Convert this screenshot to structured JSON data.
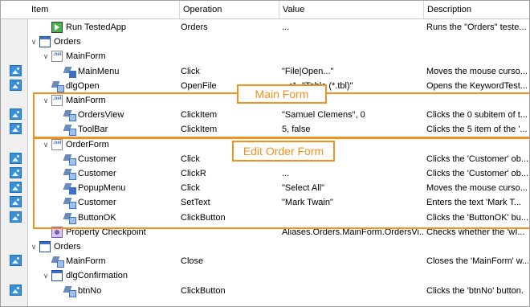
{
  "columns": {
    "item": "Item",
    "operation": "Operation",
    "value": "Value",
    "description": "Description"
  },
  "rows": [
    {
      "item": "Run TestedApp",
      "op": "Orders",
      "val": "...",
      "desc": "Runs the \"Orders\" teste...",
      "indent": 2,
      "icon": "run-icon",
      "toggle": "",
      "thumb": false
    },
    {
      "item": "Orders",
      "op": "",
      "val": "",
      "desc": "",
      "indent": 1,
      "icon": "window-icon",
      "toggle": "∨",
      "thumb": false
    },
    {
      "item": "MainForm",
      "op": "",
      "val": "",
      "desc": "",
      "indent": 2,
      "icon": "net-form-icon",
      "toggle": "∨",
      "thumb": false
    },
    {
      "item": "MainMenu",
      "op": "Click",
      "val": "\"File|Open...\"",
      "desc": "Moves the mouse curso...",
      "indent": 3,
      "icon": "menu-action-icon",
      "toggle": "",
      "thumb": true
    },
    {
      "item": "dlgOpen",
      "op": "OpenFile",
      "val": "...r1, \"Table (*.tbl)\"",
      "desc": "Opens the KeywordTest...",
      "indent": 2,
      "icon": "action-icon",
      "toggle": "",
      "thumb": true
    },
    {
      "item": "MainForm",
      "op": "",
      "val": "",
      "desc": "",
      "indent": 2,
      "icon": "net-form-icon",
      "toggle": "∨",
      "thumb": false
    },
    {
      "item": "OrdersView",
      "op": "ClickItem",
      "val": "\"Samuel Clemens\", 0",
      "desc": "Clicks the 0 subitem of t...",
      "indent": 3,
      "icon": "action-icon",
      "toggle": "",
      "thumb": true
    },
    {
      "item": "ToolBar",
      "op": "ClickItem",
      "val": "5, false",
      "desc": "Clicks the 5 item of the '...",
      "indent": 3,
      "icon": "action-icon",
      "toggle": "",
      "thumb": true
    },
    {
      "item": "OrderForm",
      "op": "",
      "val": "",
      "desc": "",
      "indent": 2,
      "icon": "net-form-icon",
      "toggle": "∨",
      "thumb": false
    },
    {
      "item": "Customer",
      "op": "Click",
      "val": "...",
      "desc": "Clicks the 'Customer' ob...",
      "indent": 3,
      "icon": "action-icon",
      "toggle": "",
      "thumb": true
    },
    {
      "item": "Customer",
      "op": "ClickR",
      "val": "...",
      "desc": "Clicks the 'Customer' ob...",
      "indent": 3,
      "icon": "action-icon",
      "toggle": "",
      "thumb": true
    },
    {
      "item": "PopupMenu",
      "op": "Click",
      "val": "\"Select All\"",
      "desc": "Moves the mouse curso...",
      "indent": 3,
      "icon": "menu-action-icon",
      "toggle": "",
      "thumb": true
    },
    {
      "item": "Customer",
      "op": "SetText",
      "val": "\"Mark Twain\"",
      "desc": "Enters the text 'Mark T...",
      "indent": 3,
      "icon": "action-icon",
      "toggle": "",
      "thumb": true
    },
    {
      "item": "ButtonOK",
      "op": "ClickButton",
      "val": "",
      "desc": "Clicks the 'ButtonOK' bu...",
      "indent": 3,
      "icon": "action-icon",
      "toggle": "",
      "thumb": true
    },
    {
      "item": "Property Checkpoint",
      "op": "",
      "val": "Aliases.Orders.MainForm.OrdersVi...",
      "desc": "Checks whether the 'wI...",
      "indent": 2,
      "icon": "checkpoint-icon",
      "toggle": "",
      "thumb": false
    },
    {
      "item": "Orders",
      "op": "",
      "val": "",
      "desc": "",
      "indent": 1,
      "icon": "window-icon",
      "toggle": "∨",
      "thumb": false
    },
    {
      "item": "MainForm",
      "op": "Close",
      "val": "",
      "desc": "Closes the 'MainForm' w...",
      "indent": 2,
      "icon": "action-icon",
      "toggle": "",
      "thumb": true
    },
    {
      "item": "dlgConfirmation",
      "op": "",
      "val": "",
      "desc": "",
      "indent": 2,
      "icon": "window-icon",
      "toggle": "∨",
      "thumb": false
    },
    {
      "item": "btnNo",
      "op": "ClickButton",
      "val": "",
      "desc": "Clicks the 'btnNo' button.",
      "indent": 3,
      "icon": "action-icon",
      "toggle": "",
      "thumb": true
    }
  ],
  "callouts": {
    "main_form": "Main Form",
    "edit_order_form": "Edit Order Form"
  },
  "colors": {
    "accent": "#f39020",
    "icon_blue": "#3d6fc9"
  }
}
